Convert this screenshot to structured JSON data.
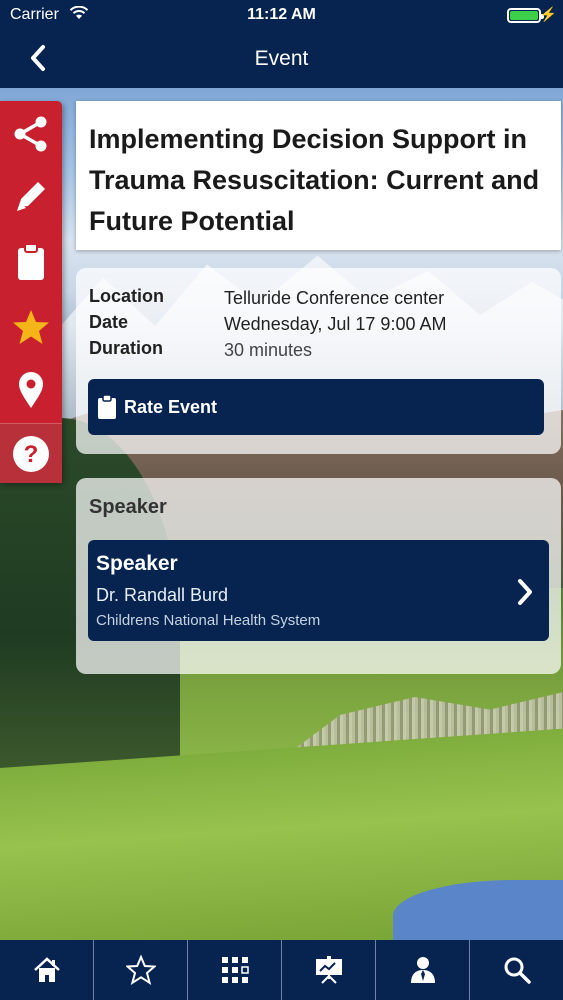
{
  "status_bar": {
    "carrier": "Carrier",
    "time": "11:12 AM",
    "battery_level": 1.0,
    "battery_color": "#3cd04a"
  },
  "nav": {
    "title": "Event",
    "back_icon": "chevron-left-icon"
  },
  "side_actions": [
    {
      "icon": "share-icon"
    },
    {
      "icon": "pencil-icon"
    },
    {
      "icon": "clipboard-icon"
    },
    {
      "icon": "star-icon"
    },
    {
      "icon": "location-pin-icon"
    },
    {
      "icon": "help-icon"
    }
  ],
  "event": {
    "title": "Implementing Decision Support in Trauma Resuscitation: Current and Future Potential",
    "details": {
      "location_label": "Location",
      "location_value": "Telluride Conference center",
      "date_label": "Date",
      "date_value": "Wednesday, Jul 17 9:00 AM",
      "duration_label": "Duration",
      "duration_value": "30 minutes"
    },
    "rate_button_label": "Rate Event"
  },
  "speaker_section": {
    "heading": "Speaker",
    "items": [
      {
        "role": "Speaker",
        "name": "Dr. Randall Burd",
        "organization": "Childrens National Health System"
      }
    ]
  },
  "tab_bar": {
    "tabs": [
      {
        "icon": "home-icon"
      },
      {
        "icon": "star-outline-icon"
      },
      {
        "icon": "grid-icon"
      },
      {
        "icon": "presentation-icon"
      },
      {
        "icon": "person-icon"
      },
      {
        "icon": "search-icon"
      }
    ]
  },
  "colors": {
    "navy": "#06244f",
    "rail_red": "#c8202e",
    "star_gold": "#f5b417"
  }
}
